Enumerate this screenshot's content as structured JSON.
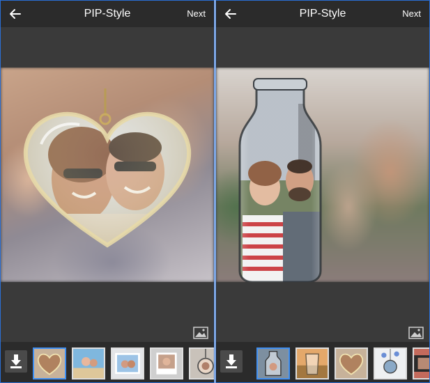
{
  "screens": [
    {
      "header": {
        "title": "PIP-Style",
        "next_label": "Next"
      },
      "frame": "heart-pendant",
      "thumbnails": [
        {
          "name": "heart",
          "selected": true
        },
        {
          "name": "beach",
          "selected": false
        },
        {
          "name": "frame",
          "selected": false
        },
        {
          "name": "polaroid",
          "selected": false
        },
        {
          "name": "pendant",
          "selected": false
        }
      ]
    },
    {
      "header": {
        "title": "PIP-Style",
        "next_label": "Next"
      },
      "frame": "glass-bottle",
      "thumbnails": [
        {
          "name": "bottle",
          "selected": true
        },
        {
          "name": "glass",
          "selected": false
        },
        {
          "name": "heart",
          "selected": false
        },
        {
          "name": "hanging",
          "selected": false
        },
        {
          "name": "film",
          "selected": false
        }
      ]
    }
  ],
  "colors": {
    "accent": "#3f8ff2",
    "header_bg": "#2b2b2b",
    "workspace_bg": "#3a3a3a"
  }
}
